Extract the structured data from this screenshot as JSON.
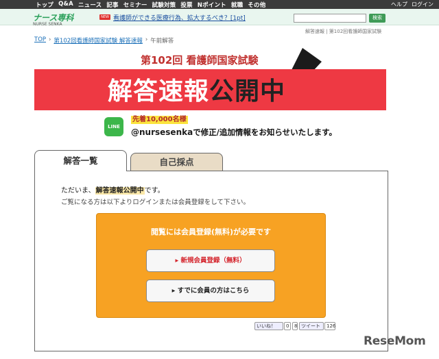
{
  "topnav": {
    "items": [
      "トップ",
      "Q&A",
      "ニュース",
      "記事",
      "セミナー",
      "試験対策",
      "投票",
      "Nポイント",
      "就職",
      "その他"
    ],
    "right": [
      "ヘルプ",
      "ログイン"
    ]
  },
  "site": {
    "logo": "ナース専科",
    "logo_sub": "NURSE SENKA"
  },
  "headline": {
    "badge": "NEW",
    "text": "看護師ができる医療行為、拡大するべき？[1pt]"
  },
  "search": {
    "placeholder": "",
    "button": "検索"
  },
  "rightlinks": "解答速報 | 第102回看護師国家試験",
  "breadcrumb": [
    "TOP",
    "第102回看護師国家試験 解答速報",
    "午前解答"
  ],
  "banner": {
    "subtitle": "第102回 看護師国家試験",
    "main_white": "解答速報",
    "main_dark": "公開中"
  },
  "line": {
    "icon_label": "LINE",
    "badge": "先着10,000名様",
    "account": "@nursesenka",
    "message": "で修正/追加情報をお知らせいたします。"
  },
  "tabs": [
    "解答一覧",
    "自己採点"
  ],
  "message": {
    "line1_pre": "ただいま、",
    "line1_hl": "解答速報公開中",
    "line1_post": "です。",
    "line2": "ご覧になる方は以下よりログインまたは会員登録をして下さい。"
  },
  "signup": {
    "title": "閲覧には会員登録(無料)が必要です",
    "register_button": "▸ 新規会員登録（無料）",
    "login_button": "▸ すでに会員の方はこちら"
  },
  "social": {
    "like": "いいね！",
    "like_count": "0",
    "tweet": "ツイート",
    "tweet_count": "126",
    "gplus": "8"
  },
  "watermark": "ReseMom"
}
